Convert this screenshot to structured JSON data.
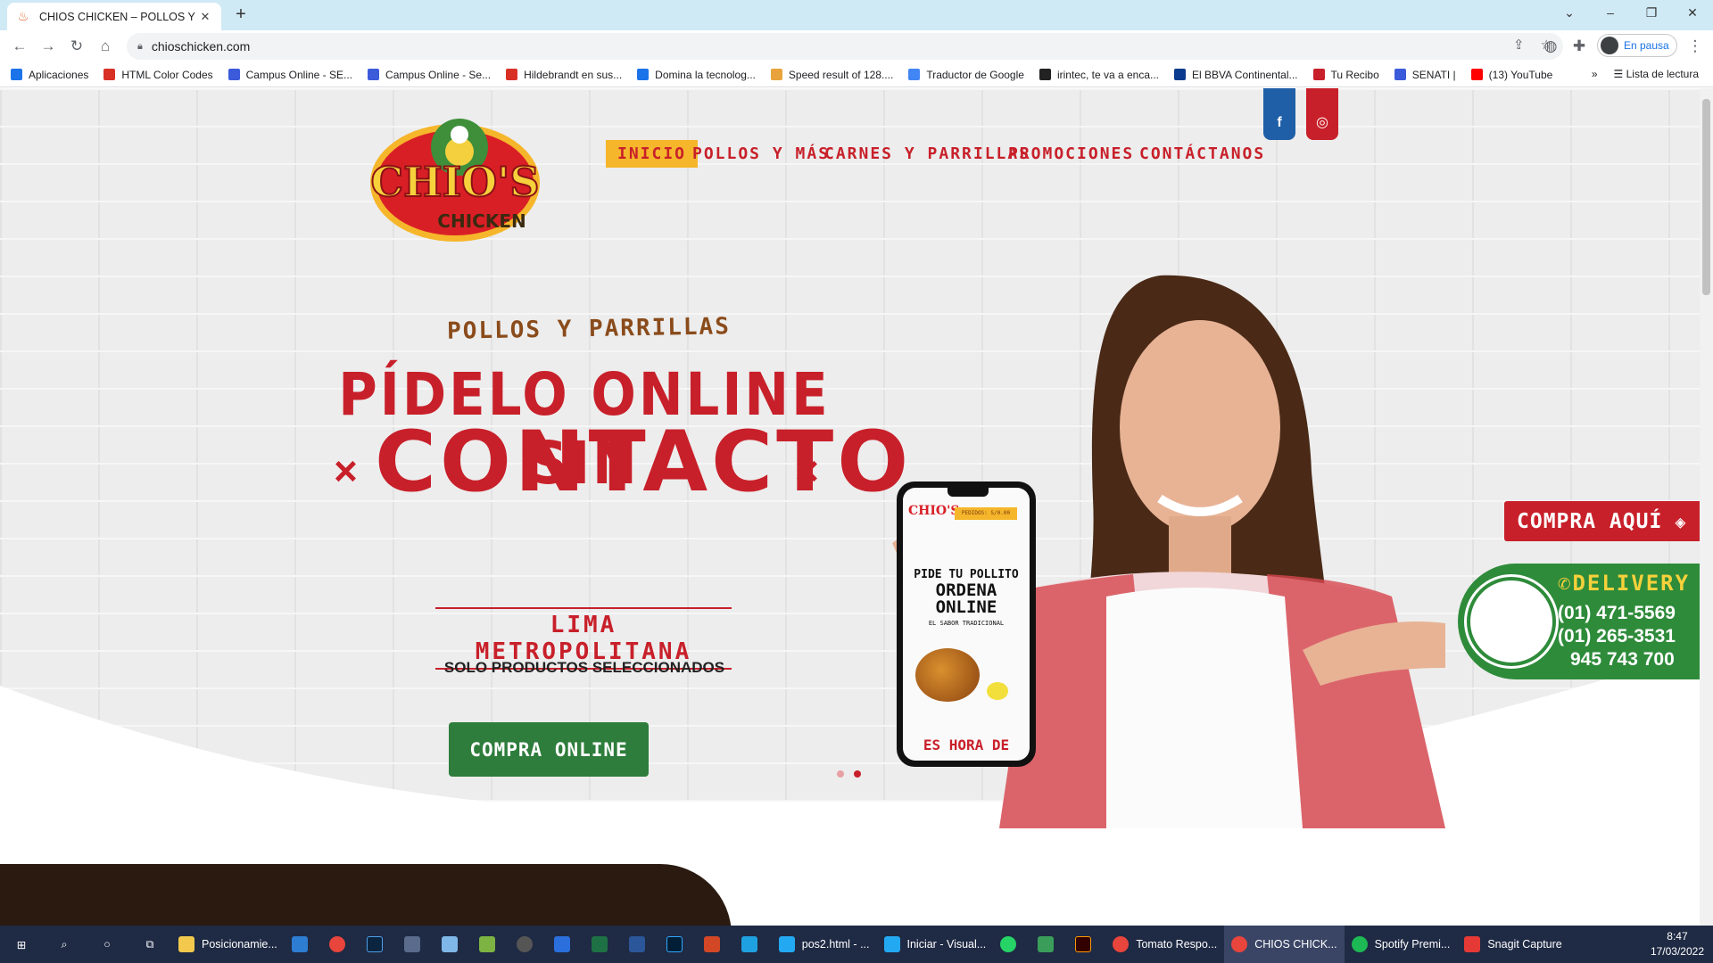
{
  "browser": {
    "tab_title": "CHIOS CHICKEN – POLLOS Y PAR",
    "url": "chioschicken.com",
    "profile_label": "En pausa",
    "bookmarks": [
      {
        "label": "Aplicaciones",
        "color": "#1a73e8"
      },
      {
        "label": "HTML Color Codes",
        "color": "#d93025"
      },
      {
        "label": "Campus Online - SE...",
        "color": "#3b5bdb"
      },
      {
        "label": "Campus Online - Se...",
        "color": "#3b5bdb"
      },
      {
        "label": "Hildebrandt en sus...",
        "color": "#d93025"
      },
      {
        "label": "Domina la tecnolog...",
        "color": "#1a73e8"
      },
      {
        "label": "Speed result of 128....",
        "color": "#e8a33d"
      },
      {
        "label": "Traductor de Google",
        "color": "#4285f4"
      },
      {
        "label": "irintec, te va a enca...",
        "color": "#222222"
      },
      {
        "label": "El BBVA Continental...",
        "color": "#0b3b8c"
      },
      {
        "label": "Tu Recibo",
        "color": "#c8202a"
      },
      {
        "label": "SENATI |",
        "color": "#3b5bdb"
      },
      {
        "label": "(13) YouTube",
        "color": "#ff0000"
      }
    ],
    "bookmarks_more": "»",
    "reading_list": "Lista de lectura"
  },
  "site": {
    "logo_text": "CHIO'S",
    "logo_sub": "CHICKEN",
    "nav": [
      "INICIO",
      "POLLOS Y MÁS",
      "CARNES Y PARRILLAS",
      "PROMOCIONES",
      "CONTÁCTANOS"
    ],
    "social": {
      "facebook": "facebook-icon",
      "instagram": "instagram-icon"
    },
    "hero": {
      "kicker": "POLLOS Y PARRILLAS",
      "headline_1": "PÍDELO ONLINE SIN",
      "headline_2": "CONTACTO",
      "x_mark": "×",
      "region": "LIMA METROPOLITANA",
      "note": "SOLO PRODUCTOS SELECCIONADOS",
      "cta": "COMPRA ONLINE"
    },
    "phone_screen": {
      "logo": "CHIO'S",
      "header_bar": "PEDIDOS: S/0.00",
      "line1": "PIDE TU POLLITO",
      "line2": "ORDENA",
      "line3": "ONLINE",
      "tagline": "EL SABOR TRADICIONAL",
      "bottom": "ES HORA DE"
    },
    "compra_aqui": "COMPRA AQUÍ",
    "delivery": {
      "title": "DELIVERY",
      "phones": [
        "(01) 471-5569",
        "(01) 265-3531",
        "945 743 700"
      ]
    },
    "slider_dots": 2,
    "colors": {
      "brand_red": "#c8202a",
      "brand_yellow": "#f6b62b",
      "brand_green": "#2e7d3c"
    }
  },
  "taskbar": {
    "items": [
      "Posicionamie...",
      "pos2.html - ...",
      "Iniciar - Visual...",
      "Tomato Respo...",
      "CHIOS CHICK...",
      "Spotify Premi...",
      "Snagit Capture"
    ],
    "time": "8:47",
    "date": "17/03/2022"
  }
}
